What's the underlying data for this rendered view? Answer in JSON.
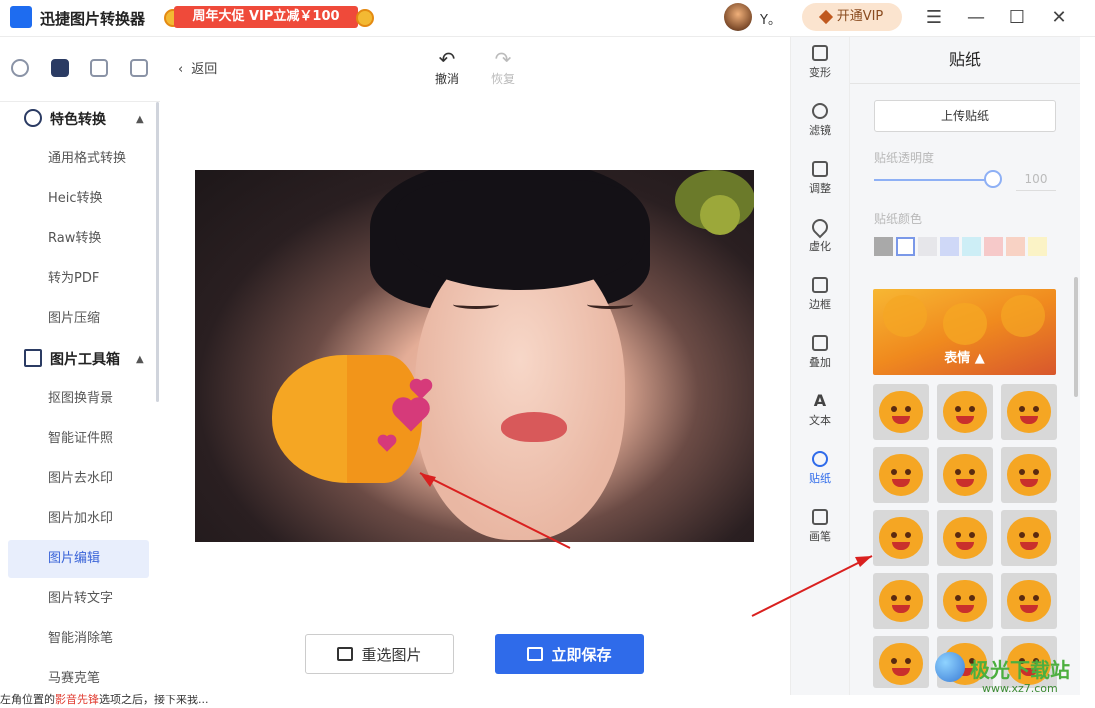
{
  "app": {
    "title": "迅捷图片转换器",
    "user_name": "Y。",
    "vip_button": "开通VIP"
  },
  "promo": {
    "text": "周年大促 VIP立减￥100"
  },
  "window_controls": {
    "menu": "☰",
    "minimize": "—",
    "maximize": "☐",
    "close": "✕"
  },
  "sidebar": {
    "sections": [
      {
        "label": "特色转换",
        "items": [
          "通用格式转换",
          "Heic转换",
          "Raw转换",
          "转为PDF",
          "图片压缩"
        ]
      },
      {
        "label": "图片工具箱",
        "items": [
          "抠图换背景",
          "智能证件照",
          "图片去水印",
          "图片加水印",
          "图片编辑",
          "图片转文字",
          "智能消除笔",
          "马赛克笔"
        ]
      }
    ],
    "active_item": "图片编辑"
  },
  "bottom_text": {
    "prefix": "左角位置的",
    "highlight": "影音先锋",
    "suffix": "选项之后，接下来我..."
  },
  "editor": {
    "back_label": "返回",
    "undo_label": "撤消",
    "redo_label": "恢复",
    "reselect_button": "重选图片",
    "save_button": "立即保存"
  },
  "tools": [
    "变形",
    "滤镜",
    "调整",
    "虚化",
    "边框",
    "叠加",
    "文本",
    "贴纸",
    "画笔"
  ],
  "active_tool": "贴纸",
  "sticker_panel": {
    "title": "贴纸",
    "upload_button": "上传贴纸",
    "opacity_label": "贴纸透明度",
    "opacity_value": "100",
    "color_label": "贴纸颜色",
    "swatches": [
      "#a9a9a9",
      "#ffffff",
      "#e6e6ea",
      "#cfd8f7",
      "#cdeef6",
      "#f6c9c9",
      "#f8d2c4",
      "#fbf3c6"
    ],
    "category_label": "表情 ▲"
  },
  "watermark": {
    "brand": "极光下载站",
    "url": "www.xz7.com"
  }
}
